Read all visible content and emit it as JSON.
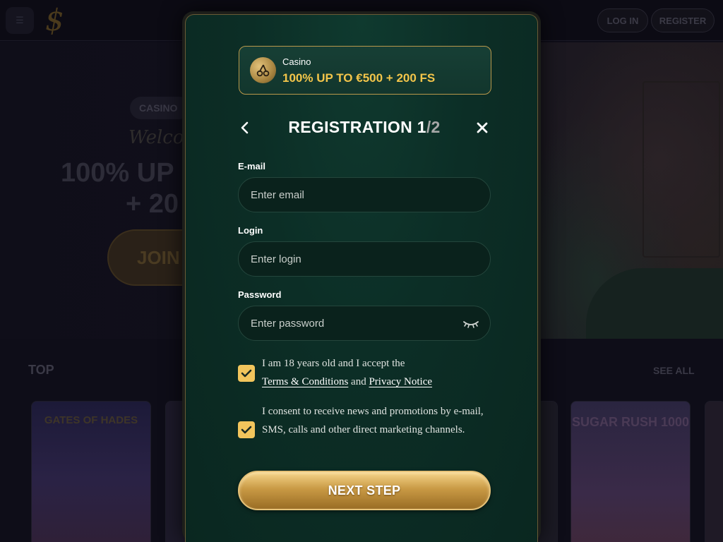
{
  "background": {
    "header": {
      "menu_icon": "menu-search-icon",
      "logo_glyph": "$",
      "login_label": "LOG IN",
      "register_label": "REGISTER"
    },
    "hero": {
      "badge": "CASINO",
      "welcome": "Welcome",
      "headline_line1": "100% UP",
      "headline_line2": "+ 20",
      "join_label": "JOIN"
    },
    "top_section": {
      "title": "TOP",
      "see_all": "SEE ALL",
      "cards": [
        {
          "title": "GATES OF HADES"
        },
        {
          "title": ""
        },
        {
          "title": ""
        },
        {
          "title": "SUGAR RUSH 1000"
        },
        {
          "title": ""
        }
      ]
    }
  },
  "modal": {
    "promo": {
      "icon": "cherry-coin-icon",
      "label": "Casino",
      "title": "100% UP TO €500 + 200 FS"
    },
    "title_main": "REGISTRATION 1",
    "title_step": "/2",
    "back_icon": "chevron-left-icon",
    "close_icon": "close-icon",
    "fields": {
      "email": {
        "label": "E-mail",
        "placeholder": "Enter email",
        "value": ""
      },
      "login": {
        "label": "Login",
        "placeholder": "Enter login",
        "value": ""
      },
      "password": {
        "label": "Password",
        "placeholder": "Enter password",
        "value": "",
        "toggle_icon": "eye-closed-icon"
      }
    },
    "consents": {
      "age": {
        "checked": true,
        "text_before": "I am 18 years old and I accept the",
        "terms_link": "Terms & Conditions",
        "and": "and",
        "privacy_link": "Privacy Notice"
      },
      "marketing": {
        "checked": true,
        "text": "I consent to receive news and promotions by e-mail, SMS, calls and other direct marketing channels."
      }
    },
    "next_label": "NEXT STEP"
  },
  "colors": {
    "accent_gold": "#f3c54a",
    "checkbox": "#f2c55c",
    "modal_bg": "#0c2e26",
    "page_bg": "#0e0d18"
  }
}
